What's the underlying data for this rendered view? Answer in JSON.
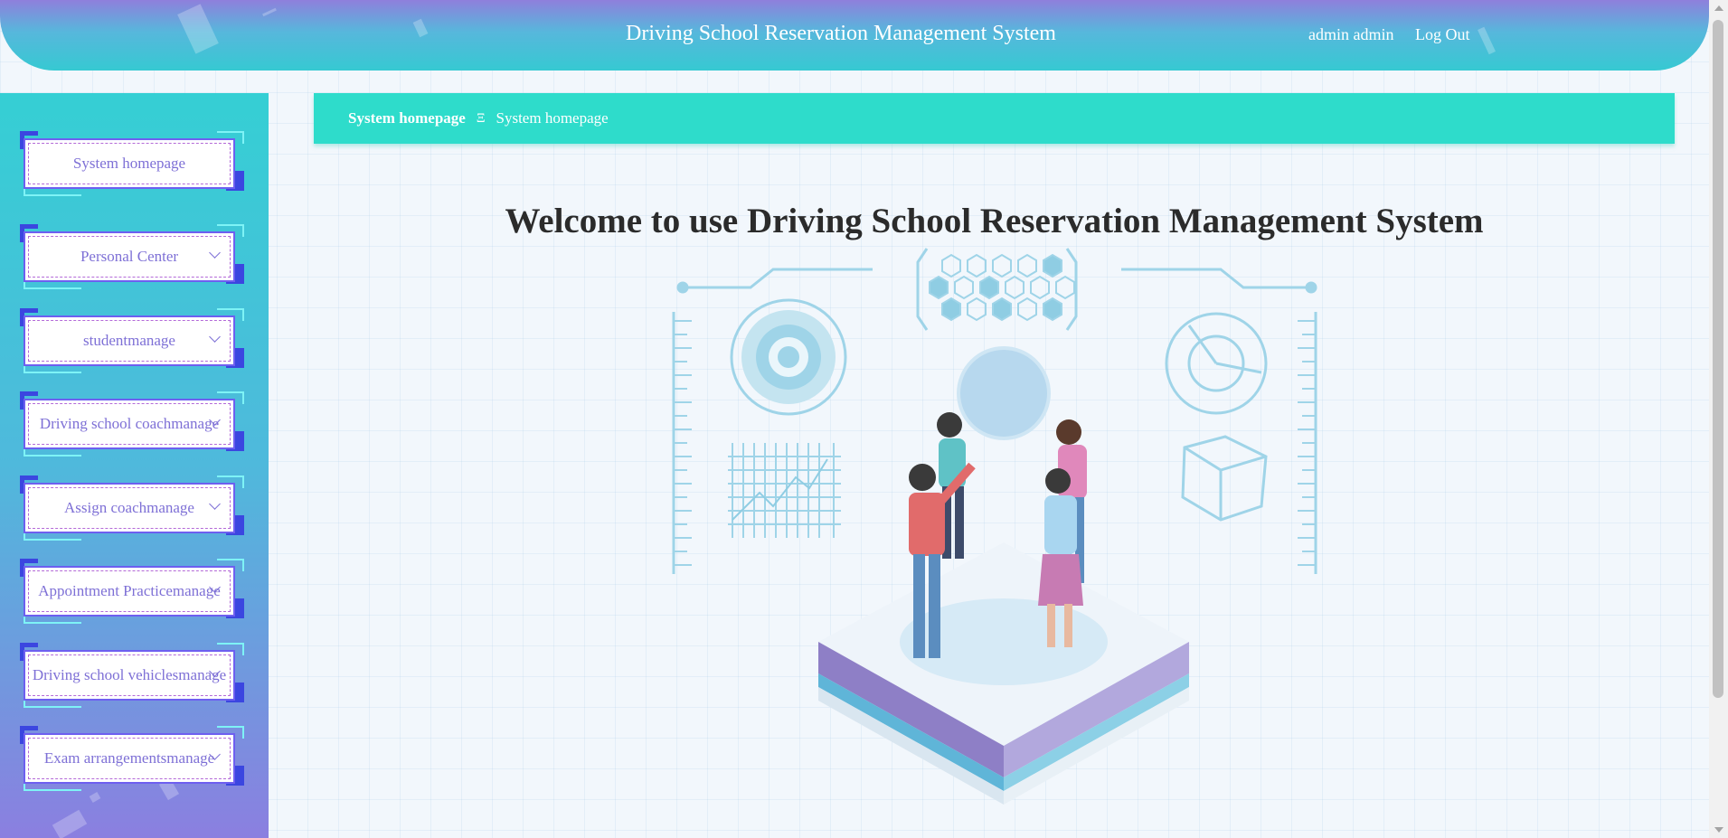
{
  "header": {
    "title": "Driving School Reservation Management System",
    "user": "admin admin",
    "logout": "Log Out"
  },
  "sidebar": {
    "items": [
      {
        "label": "System homepage",
        "has_submenu": false
      },
      {
        "label": "Personal Center",
        "has_submenu": true
      },
      {
        "label": "studentmanage",
        "has_submenu": true
      },
      {
        "label": "Driving school coachmanage",
        "has_submenu": true
      },
      {
        "label": "Assign coachmanage",
        "has_submenu": true
      },
      {
        "label": "Appointment Practicemanage",
        "has_submenu": true
      },
      {
        "label": "Driving school vehiclesmanage",
        "has_submenu": true
      },
      {
        "label": "Exam arrangementsmanage",
        "has_submenu": true
      }
    ]
  },
  "breadcrumb": {
    "home": "System homepage",
    "separator": "Ξ",
    "current": "System homepage"
  },
  "main": {
    "welcome": "Welcome to use Driving School Reservation Management System"
  },
  "colors": {
    "breadcrumb_bg": "#2edccb",
    "menu_text": "#7e70d6",
    "menu_border": "#6e5ff0"
  },
  "icons": {
    "submenu": "chevron-down-icon",
    "illustration": "team-vr-hologram-illustration"
  }
}
